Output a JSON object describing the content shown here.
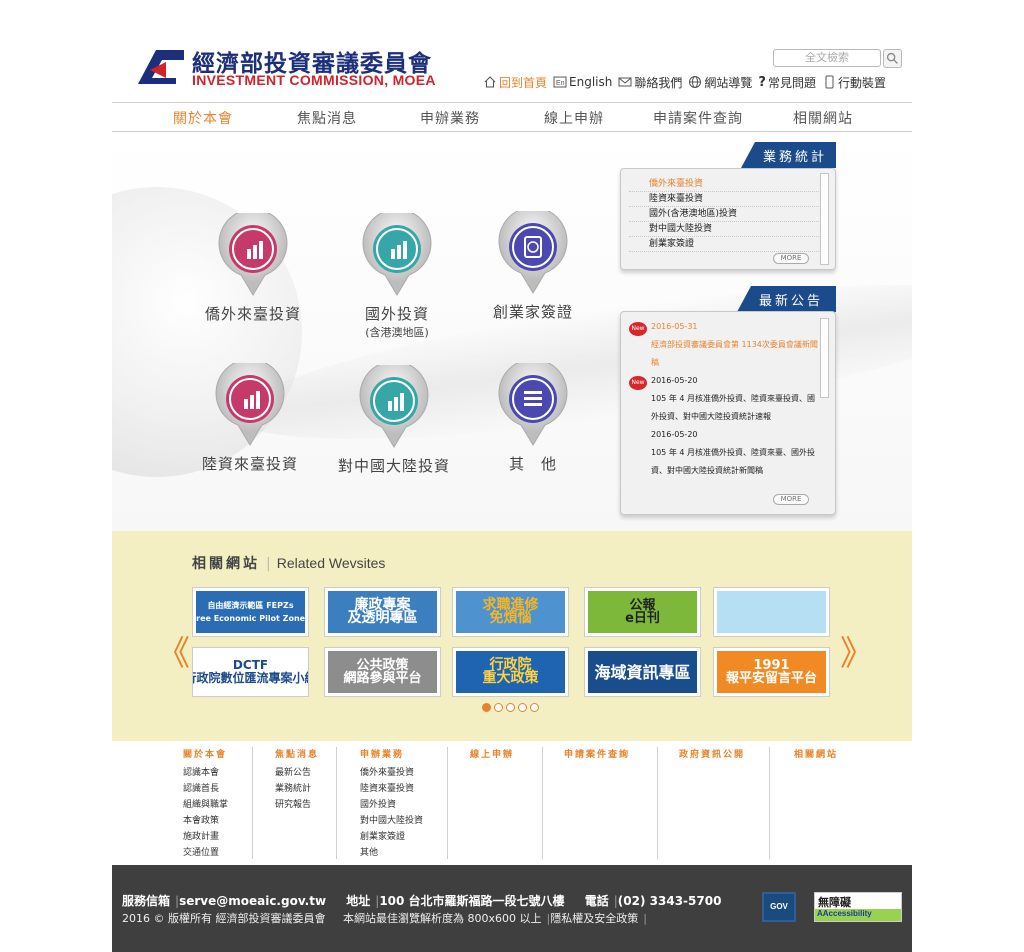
{
  "header": {
    "logo_cn": "經濟部投資審議委員會",
    "logo_en": "INVESTMENT COMMISSION, MOEA",
    "search_placeholder": "全文檢索",
    "toplinks": [
      {
        "label": "回到首頁",
        "icon": "home-icon"
      },
      {
        "label": "English",
        "icon": "en-icon"
      },
      {
        "label": "聯絡我們",
        "icon": "mail-icon"
      },
      {
        "label": "網站導覽",
        "icon": "globe-icon"
      },
      {
        "label": "常見問題",
        "icon": "question-icon"
      },
      {
        "label": "行動裝置",
        "icon": "mobile-icon"
      }
    ]
  },
  "nav": [
    "關於本會",
    "焦點消息",
    "申辦業務",
    "線上申辦",
    "申請案件查詢",
    "相關網站"
  ],
  "categories": [
    {
      "label": "僑外來臺投資",
      "sub": "",
      "color": "#c63a6a"
    },
    {
      "label": "國外投資",
      "sub": "(含港澳地區)",
      "color": "#37a6a8"
    },
    {
      "label": "創業家簽證",
      "sub": "",
      "color": "#4b49b0"
    },
    {
      "label": "陸資來臺投資",
      "sub": "",
      "color": "#c63a6a"
    },
    {
      "label": "對中國大陸投資",
      "sub": "",
      "color": "#37a6a8"
    },
    {
      "label": "其　他",
      "sub": "",
      "color": "#4b49b0"
    }
  ],
  "stats_panel": {
    "title": "業務統計",
    "items": [
      "僑外來臺投資",
      "陸資來臺投資",
      "國外(含港澳地區)投資",
      "對中國大陸投資",
      "創業家簽證"
    ],
    "more": "MORE"
  },
  "news_panel": {
    "title": "最新公告",
    "items": [
      {
        "date": "2016-05-31",
        "text": "經濟部投資審議委員會第 1134次委員會議新聞稿",
        "new": "New"
      },
      {
        "date": "2016-05-20",
        "text": "105 年 4 月核准僑外投資、陸資來臺投資、國外投資、對中國大陸投資統計速報",
        "new": "New"
      },
      {
        "date": "2016-05-20",
        "text": "105 年 4 月核准僑外投資、陸資來臺、國外投資、對中國大陸投資統計新聞稿",
        "new": ""
      }
    ],
    "more": "MORE"
  },
  "related": {
    "title_cn": "相關網站",
    "title_en": "Related Wevsites",
    "prev": "《",
    "next": "》",
    "banners": [
      {
        "text": "自由經濟示範區 FEPZs\nFree Economic Pilot Zones",
        "bg": "#2a6db5"
      },
      {
        "text": "廉政專案\n及透明專區",
        "bg": "#3c7fc0"
      },
      {
        "text": "求職進修\n免煩惱",
        "bg": "#4e92d0"
      },
      {
        "text": "公報\ne日刊",
        "bg": "#7db83a"
      },
      {
        "text": "",
        "bg": "#b7dff3"
      },
      {
        "text": "DCTF\n行政院數位匯流專案小組",
        "bg": "#ffffff"
      },
      {
        "text": "公共政策\n網路參與平台",
        "bg": "#8d8d8d"
      },
      {
        "text": "行政院\n重大政策",
        "bg": "#1f64b0"
      },
      {
        "text": "海域資訊專區",
        "bg": "#1a4d8c"
      },
      {
        "text": "1991\n報平安留言平台",
        "bg": "#f18a22"
      }
    ],
    "dots": 5
  },
  "sitemap": [
    {
      "head": "關於本會",
      "items": [
        "認識本會",
        "認識首長",
        "組織與職掌",
        "本會政策",
        "施政計畫",
        "交通位置"
      ]
    },
    {
      "head": "焦點消息",
      "items": [
        "最新公告",
        "業務統計",
        "研究報告"
      ]
    },
    {
      "head": "申辦業務",
      "items": [
        "僑外來臺投資",
        "陸資來臺投資",
        "國外投資",
        "對中國大陸投資",
        "創業家簽證",
        "其他"
      ]
    },
    {
      "head": "線上申辦",
      "items": []
    },
    {
      "head": "申請案件查詢",
      "items": []
    },
    {
      "head": "政府資訊公開",
      "items": []
    },
    {
      "head": "相關網站",
      "items": []
    }
  ],
  "footer": {
    "mail_label": "服務信箱",
    "mail": "serve@moeaic.gov.tw",
    "addr_label": "地址",
    "addr": "100 台北市羅斯福路一段七號八樓",
    "tel_label": "電話",
    "tel": "(02) 3343-5700",
    "copyright": "2016 © 版權所有 經濟部投資審議委員會",
    "resolution": "本網站最佳瀏覽解析度為 800x600 以上",
    "privacy": "隱私權及安全政策",
    "a11y_text": "無障礙",
    "a11y_sub": "AAccessibility",
    "gov_text": "GOV"
  }
}
